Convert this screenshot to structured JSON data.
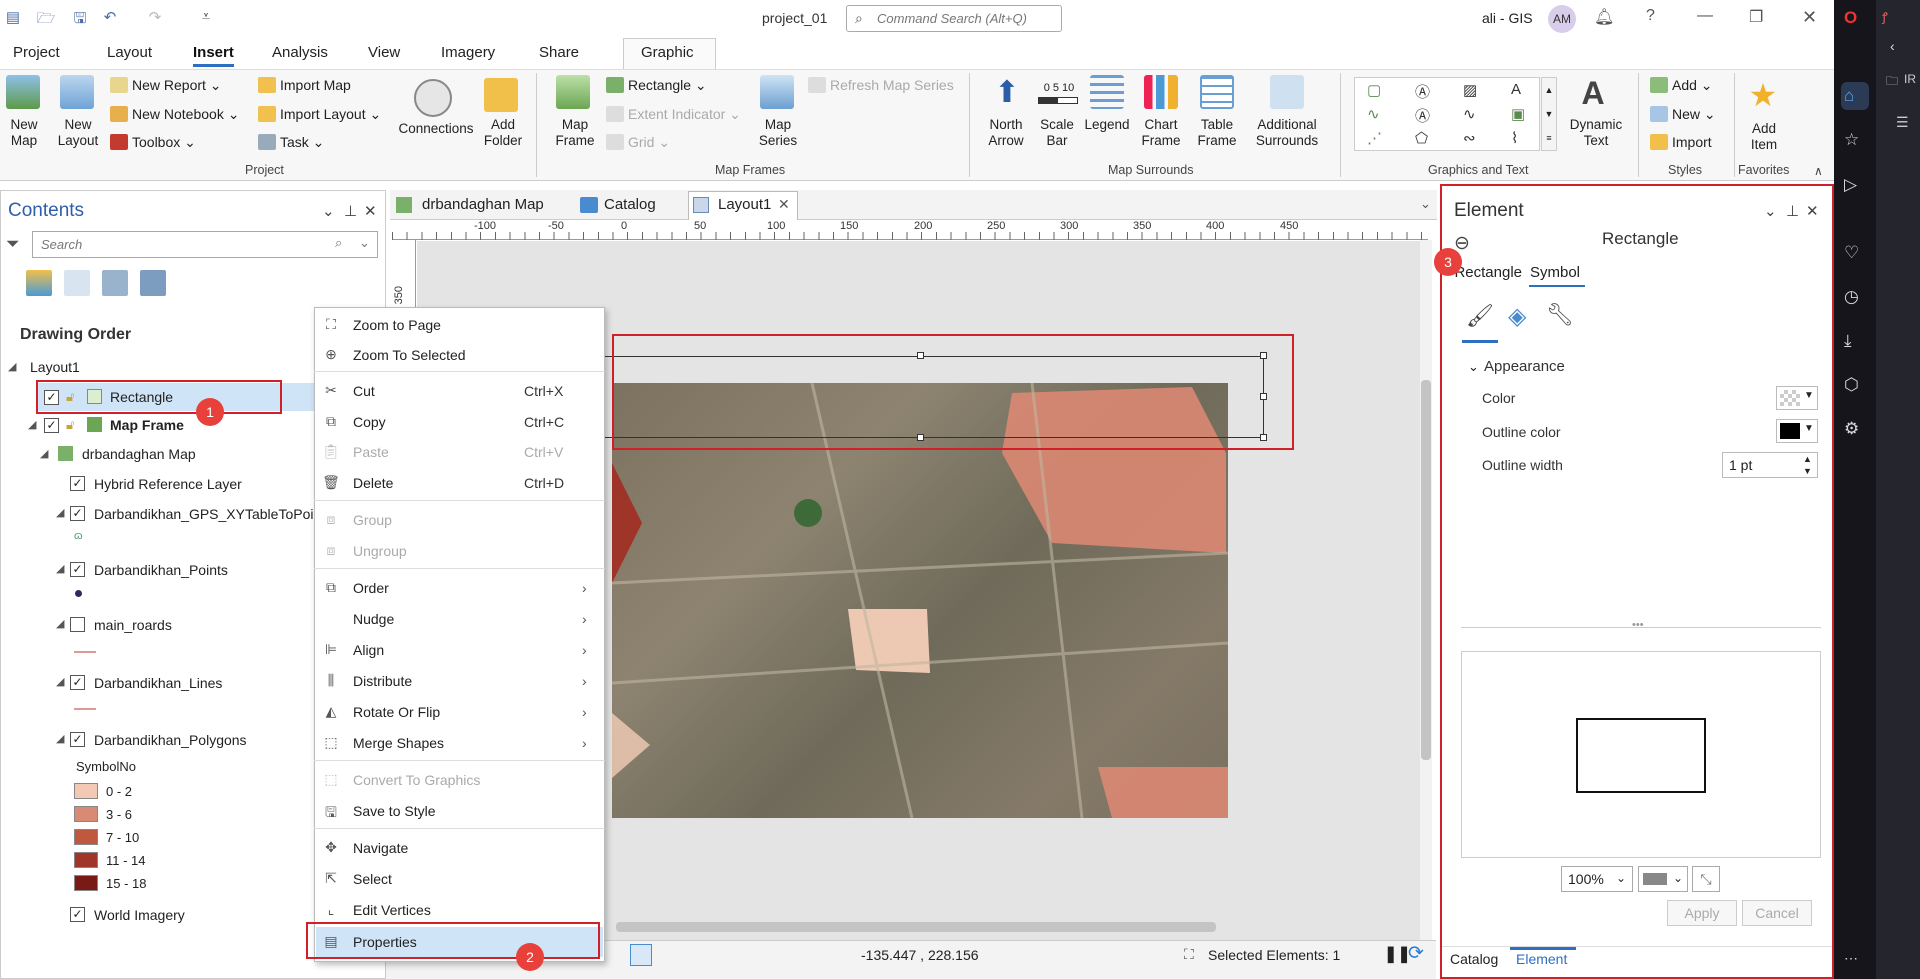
{
  "titlebar": {
    "project": "project_01",
    "search_placeholder": "Command Search (Alt+Q)",
    "user": "ali - GIS",
    "avatar": "AM",
    "help": "?"
  },
  "ribbon_tabs": [
    "Project",
    "Layout",
    "Insert",
    "Analysis",
    "View",
    "Imagery",
    "Share",
    "Graphic"
  ],
  "ribbon": {
    "project": {
      "new_map": "New Map",
      "new_layout": "New Layout",
      "new_report": "New Report",
      "new_notebook": "New Notebook",
      "toolbox": "Toolbox",
      "import_map": "Import Map",
      "import_layout": "Import Layout",
      "task": "Task",
      "connections": "Connections",
      "add_folder": "Add Folder",
      "group": "Project"
    },
    "map_frames": {
      "map_frame": "Map Frame",
      "rectangle": "Rectangle",
      "extent_indicator": "Extent Indicator",
      "grid": "Grid",
      "map_series": "Map Series",
      "refresh": "Refresh Map Series",
      "group": "Map Frames"
    },
    "surrounds": {
      "north_arrow": "North Arrow",
      "scale_bar": "Scale Bar",
      "scale_nums": "0 5 10",
      "legend": "Legend",
      "chart_frame": "Chart Frame",
      "table_frame": "Table Frame",
      "additional": "Additional Surrounds",
      "group": "Map Surrounds"
    },
    "graphics": {
      "dynamic_text": "Dynamic Text",
      "group": "Graphics and Text"
    },
    "styles": {
      "add": "Add",
      "new": "New",
      "import": "Import",
      "group": "Styles"
    },
    "favorites": {
      "add_item": "Add Item",
      "group": "Favorites"
    }
  },
  "contents": {
    "title": "Contents",
    "search_placeholder": "Search",
    "drawing_order": "Drawing Order",
    "tree": {
      "layout": "Layout1",
      "rectangle": "Rectangle",
      "map_frame": "Map Frame",
      "map": "drbandaghan Map",
      "hybrid": "Hybrid Reference Layer",
      "gps": "Darbandikhan_GPS_XYTableToPoint",
      "points": "Darbandikhan_Points",
      "roads": "main_roards",
      "lines": "Darbandikhan_Lines",
      "polygons": "Darbandikhan_Polygons",
      "symbol_field": "SymbolNo",
      "world": "World Imagery"
    },
    "legend": [
      {
        "label": "0 - 2",
        "color": "#f3c9b6"
      },
      {
        "label": "3 - 6",
        "color": "#d98a74"
      },
      {
        "label": "7 - 10",
        "color": "#c0573f"
      },
      {
        "label": "11 - 14",
        "color": "#a2352a"
      },
      {
        "label": "15 - 18",
        "color": "#7a1a17"
      }
    ]
  },
  "doc_tabs": [
    "drbandaghan Map",
    "Catalog",
    "Layout1"
  ],
  "ruler": {
    "h": [
      "-100",
      "-50",
      "0",
      "50",
      "100",
      "150",
      "200",
      "250",
      "300",
      "350",
      "400",
      "450"
    ],
    "v": [
      "350"
    ]
  },
  "context_menu": {
    "zoom_page": "Zoom to Page",
    "zoom_selected": "Zoom To Selected",
    "cut": "Cut",
    "cut_key": "Ctrl+X",
    "copy": "Copy",
    "copy_key": "Ctrl+C",
    "paste": "Paste",
    "paste_key": "Ctrl+V",
    "delete": "Delete",
    "delete_key": "Ctrl+D",
    "group": "Group",
    "ungroup": "Ungroup",
    "order": "Order",
    "nudge": "Nudge",
    "align": "Align",
    "distribute": "Distribute",
    "rotate": "Rotate Or Flip",
    "merge": "Merge Shapes",
    "convert": "Convert To Graphics",
    "save_style": "Save to Style",
    "navigate": "Navigate",
    "select": "Select",
    "edit_vertices": "Edit Vertices",
    "properties": "Properties"
  },
  "status": {
    "coords": "-135.447 , 228.156",
    "selected": "Selected Elements: 1"
  },
  "element_pane": {
    "title": "Element",
    "subtitle": "Rectangle",
    "tab1": "Rectangle",
    "tab2": "Symbol",
    "section": "Appearance",
    "color": "Color",
    "outline_color": "Outline color",
    "outline_width": "Outline width",
    "width_value": "1 pt",
    "zoom": "100%",
    "apply": "Apply",
    "cancel": "Cancel",
    "bottom_tab1": "Catalog",
    "bottom_tab2": "Element"
  },
  "browser": {
    "label": "IR"
  },
  "badges": [
    "1",
    "2",
    "3"
  ]
}
